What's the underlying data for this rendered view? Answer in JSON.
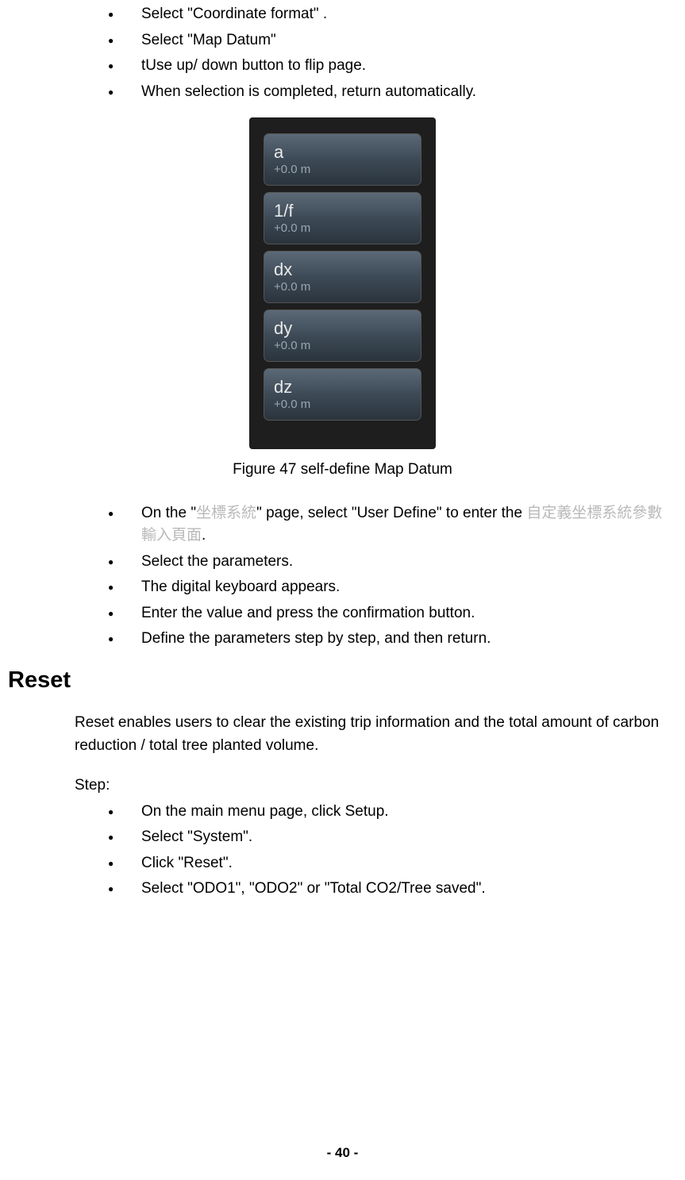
{
  "top_list": [
    "Select \"Coordinate format\" .",
    "Select \"Map Datum\"",
    "tUse up/ down button to flip page.",
    "When selection is completed, return automatically."
  ],
  "figure": {
    "caption": "Figure 47 self-define Map Datum",
    "rows": [
      {
        "key": "a",
        "val": "+0.0 m"
      },
      {
        "key": "1/f",
        "val": "+0.0 m"
      },
      {
        "key": "dx",
        "val": "+0.0 m"
      },
      {
        "key": "dy",
        "val": "+0.0 m"
      },
      {
        "key": "dz",
        "val": "+0.0 m"
      }
    ]
  },
  "mid_list_first": {
    "prefix": "On the \"",
    "grey1": "坐標系統",
    "mid": "\" page, select \"User Define\" to enter the  ",
    "grey2": "自定義坐標系統參數輸入頁面",
    "suffix": "."
  },
  "mid_list_rest": [
    "Select the parameters.",
    "The digital keyboard appears.",
    "Enter the value and press the confirmation button.",
    "Define the parameters step by step, and then return."
  ],
  "reset": {
    "heading": "Reset",
    "body": "Reset enables users to clear the existing trip information and the total amount of carbon reduction / total tree planted volume.",
    "step_label": "Step:",
    "steps": [
      "On the main menu page, click Setup.",
      "Select \"System\".",
      "Click \"Reset\".",
      "Select \"ODO1\", \"ODO2\" or \"Total CO2/Tree saved\"."
    ]
  },
  "footer": "- 40 -"
}
